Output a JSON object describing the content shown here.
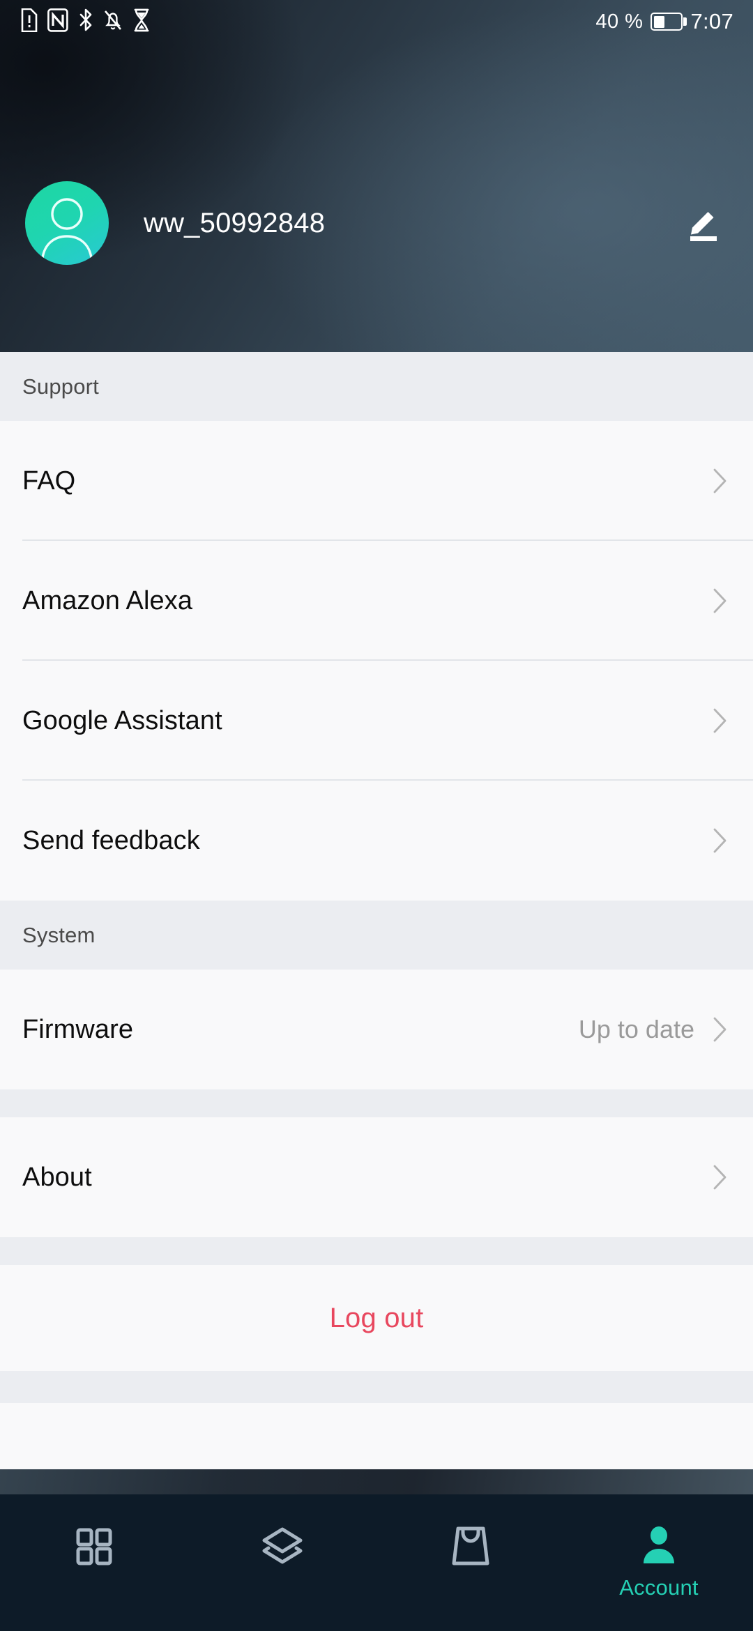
{
  "status_bar": {
    "icons": [
      "sim-alert-icon",
      "nfc-icon",
      "bluetooth-icon",
      "notifications-off-icon",
      "hourglass-icon"
    ],
    "battery_percent_label": "40 %",
    "battery_level": 40,
    "time": "7:07"
  },
  "header": {
    "username": "ww_50992848",
    "edit_icon": "pencil-edit-icon",
    "avatar_icon": "person-avatar-icon",
    "avatar_color_start": "#1ED7A2",
    "avatar_color_end": "#29C9D4"
  },
  "sections": [
    {
      "title": "Support",
      "rows": [
        {
          "label": "FAQ",
          "value": "",
          "chevron": true
        },
        {
          "label": "Amazon Alexa",
          "value": "",
          "chevron": true
        },
        {
          "label": "Google Assistant",
          "value": "",
          "chevron": true
        },
        {
          "label": "Send feedback",
          "value": "",
          "chevron": true
        }
      ]
    },
    {
      "title": "System",
      "rows": [
        {
          "label": "Firmware",
          "value": "Up to date",
          "chevron": true
        }
      ]
    }
  ],
  "about_row": {
    "label": "About",
    "value": "",
    "chevron": true
  },
  "logout": {
    "label": "Log out",
    "color": "#E8475E"
  },
  "bottom_nav": {
    "active_color": "#25D0B4",
    "inactive_color": "#A7B5C2",
    "items": [
      {
        "name": "grid-icon",
        "label": "",
        "active": false
      },
      {
        "name": "layers-icon",
        "label": "",
        "active": false
      },
      {
        "name": "shopping-bag-icon",
        "label": "",
        "active": false
      },
      {
        "name": "account-icon",
        "label": "Account",
        "active": true
      }
    ]
  }
}
